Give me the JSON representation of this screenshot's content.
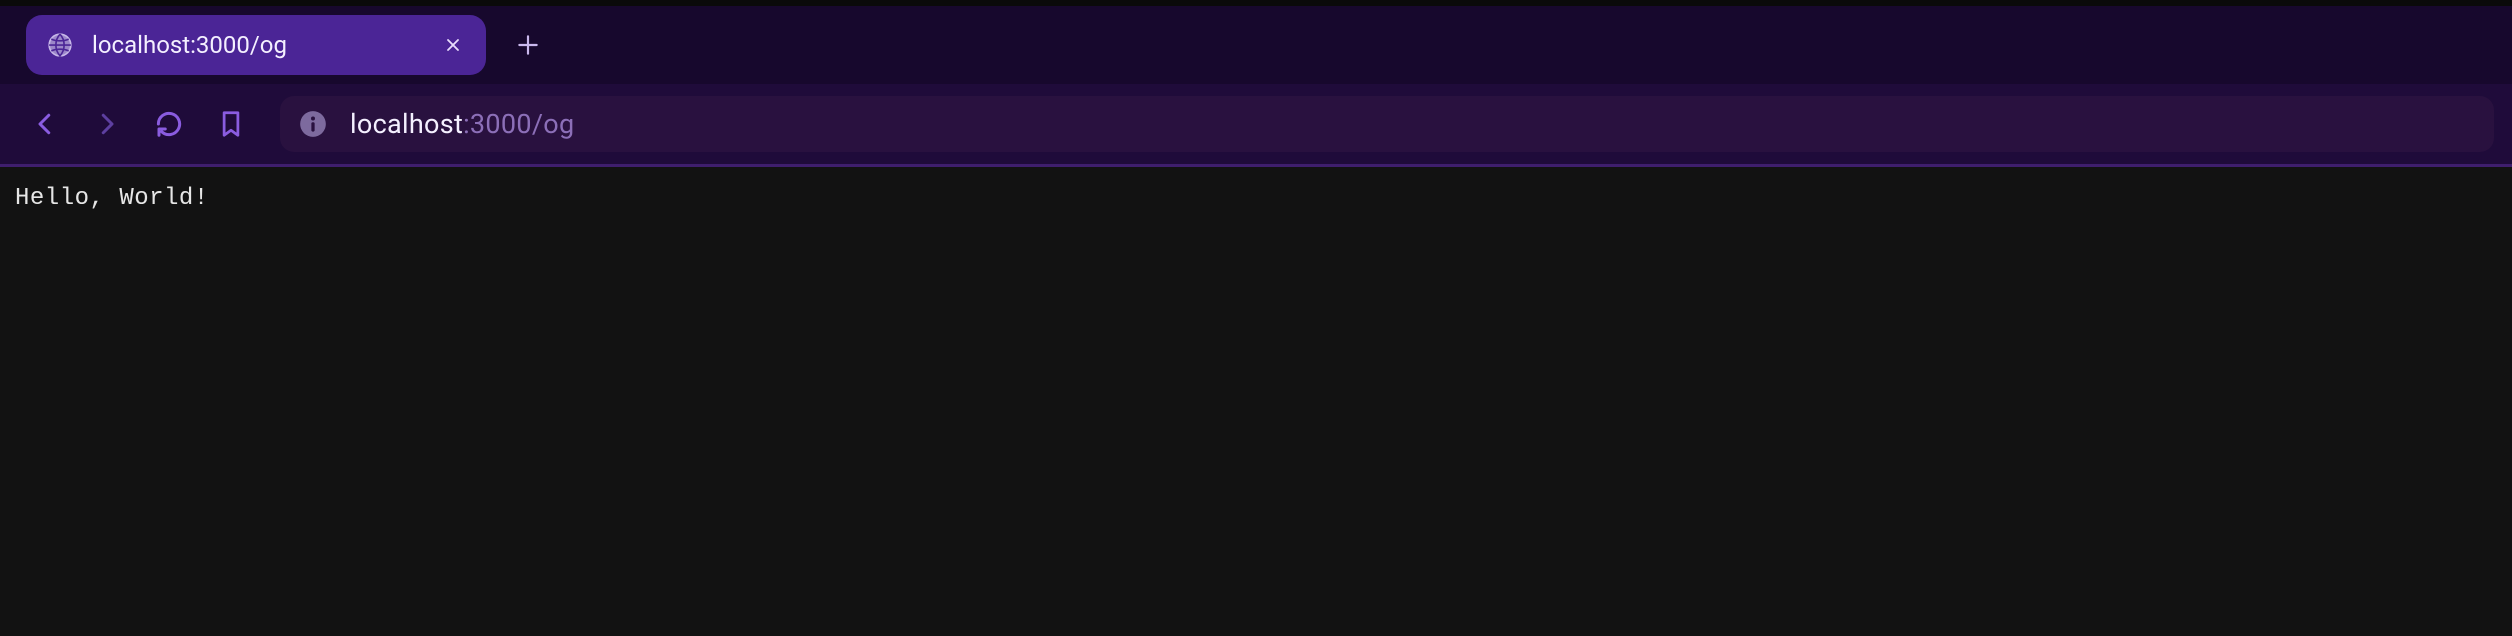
{
  "tab": {
    "title": "localhost:3000/og",
    "favicon": "globe-icon"
  },
  "toolbar": {
    "back": "back-icon",
    "forward": "forward-icon",
    "reload": "reload-icon",
    "bookmark": "bookmark-icon"
  },
  "address": {
    "site_info": "info-icon",
    "host": "localhost",
    "rest": ":3000/og"
  },
  "page": {
    "body_text": "Hello, World!"
  }
}
